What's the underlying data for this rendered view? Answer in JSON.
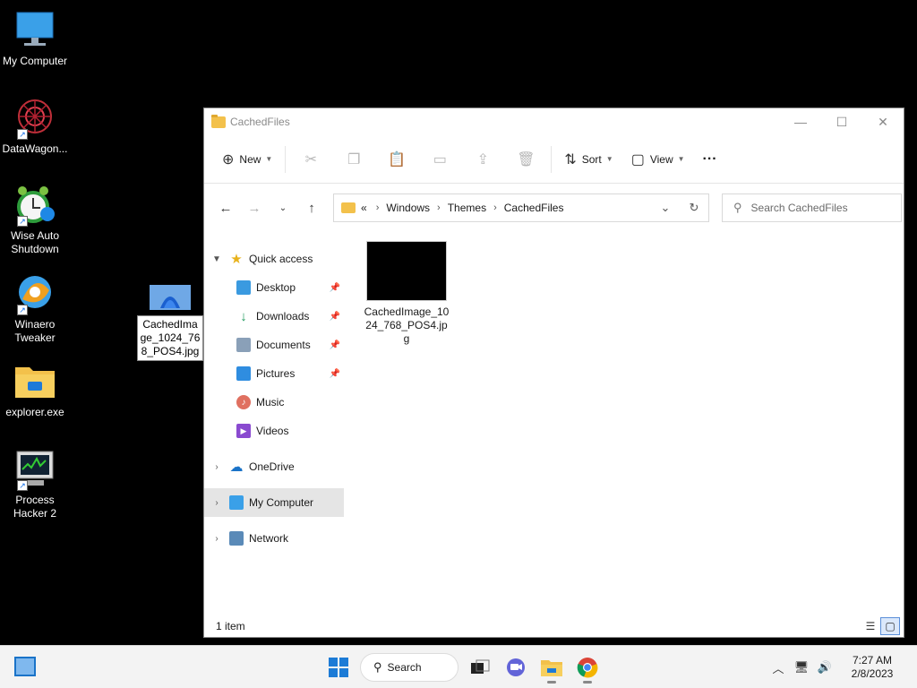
{
  "desktop": {
    "icons": [
      {
        "label": "My Computer"
      },
      {
        "label": "DataWagon..."
      },
      {
        "label": "Wise Auto Shutdown"
      },
      {
        "label": "Winaero Tweaker"
      },
      {
        "label": "explorer.exe"
      },
      {
        "label": "Process Hacker 2"
      }
    ],
    "dragged_file": {
      "label": "CachedImage_1024_768_POS4.jpg"
    }
  },
  "window": {
    "title": "CachedFiles",
    "controls": {
      "minimize": "—",
      "maximize": "☐",
      "close": "✕"
    },
    "command_bar": {
      "new_label": "New",
      "sort_label": "Sort",
      "view_label": "View",
      "more_label": "···"
    },
    "address": {
      "overflow": "«",
      "crumbs": [
        "Windows",
        "Themes",
        "CachedFiles"
      ]
    },
    "search": {
      "placeholder": "Search CachedFiles"
    },
    "nav": {
      "quick_access": "Quick access",
      "pinned": [
        "Desktop",
        "Downloads",
        "Documents",
        "Pictures"
      ],
      "unpinned": [
        "Music",
        "Videos"
      ],
      "onedrive": "OneDrive",
      "my_computer": "My Computer",
      "network": "Network"
    },
    "files": [
      {
        "name": "CachedImage_1024_768_POS4.jpg"
      }
    ],
    "status": {
      "item_count": "1 item"
    }
  },
  "taskbar": {
    "search_label": "Search",
    "clock": {
      "time": "7:27 AM",
      "date": "2/8/2023"
    }
  },
  "colors": {
    "accent": "#1c7bd6",
    "desktop_bg": "#000000",
    "folder": "#f3c14b",
    "nav_selected": "#e5e5e5"
  }
}
